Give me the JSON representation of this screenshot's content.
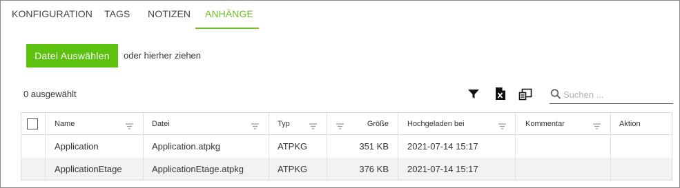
{
  "tabs": [
    {
      "label": "KONFIGURATION",
      "active": false
    },
    {
      "label": "TAGS",
      "active": false
    },
    {
      "label": "NOTIZEN",
      "active": false
    },
    {
      "label": "ANHÄNGE",
      "active": true
    }
  ],
  "upload": {
    "button_label": "Datei Auswählen",
    "drop_hint": "oder hierher ziehen"
  },
  "toolbar": {
    "selected_count": "0 ausgewählt",
    "icons": [
      "filter-icon",
      "excel-export-icon",
      "column-chooser-icon"
    ],
    "search_placeholder": "Suchen ..."
  },
  "table": {
    "columns": [
      "Name",
      "Datei",
      "Typ",
      "Größe",
      "Hochgeladen bei",
      "Kommentar",
      "Aktion"
    ],
    "rows": [
      {
        "name": "Application",
        "datei": "Application.atpkg",
        "typ": "ATPKG",
        "groesse": "351 KB",
        "hochgeladen": "2021-07-14 15:17",
        "kommentar": "",
        "aktion": ""
      },
      {
        "name": "ApplicationEtage",
        "datei": "ApplicationEtage.atpkg",
        "typ": "ATPKG",
        "groesse": "376 KB",
        "hochgeladen": "2021-07-14 15:17",
        "kommentar": "",
        "aktion": ""
      }
    ]
  },
  "colors": {
    "accent": "#6cbd22",
    "button": "#5cc10f",
    "row_alt": "#f2f2f2",
    "border": "#d8d8d8"
  }
}
